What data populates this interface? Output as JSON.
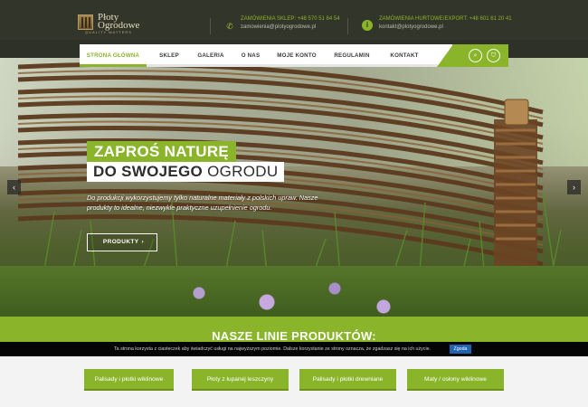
{
  "brand": {
    "name_line1": "Płoty",
    "name_line2": "Ogrodowe",
    "tagline": "QUALITY MATTERS"
  },
  "contact_shop": {
    "label": "ZAMÓWIENIA SKLEP:",
    "phone": "+48 570 51 84 54",
    "email": "zamowienia@plotyogrodowe.pl"
  },
  "contact_wholesale": {
    "label": "ZAMÓWIENIA HURTOWE/EXPORT:",
    "phone": "+48 601 61 20 41",
    "email": "kontakt@plotyogrodowe.pl"
  },
  "nav": {
    "items": [
      "STRONA GŁÓWNA",
      "SKLEP",
      "GALERIA",
      "O NAS",
      "MOJE KONTO",
      "REGULAMIN",
      "KONTAKT"
    ],
    "active": "STRONA GŁÓWNA"
  },
  "hero": {
    "headline1": "ZAPROŚ NATURĘ",
    "headline2_bold": "DO SWOJEGO",
    "headline2_rest": "OGRODU",
    "description": "Do produkcji wykorzystujemy tylko naturalne materiały z polskich upraw. Nasze produkty to idealne, niezwykle praktyczne uzupełnienie ogrodu.",
    "cta_label": "PRODUKTY",
    "cta_arrow": "›",
    "prev_arrow": "‹",
    "next_arrow": "›"
  },
  "products_section": {
    "title": "NASZE LINIE PRODUKTÓW:"
  },
  "cookie": {
    "text": "Ta strona korzysta z ciasteczek aby świadczyć usługi na najwyższym poziomie. Dalsze korzystanie ze strony oznacza, że zgadzasz się na ich użycie.",
    "accept_label": "Zgoda"
  },
  "product_lines": [
    "Palisady i płotki wiklinowe",
    "Płoty z łupanej leszczyny",
    "Palisady i płotki drewniane",
    "Maty / osłony wiklinowe"
  ],
  "colors": {
    "accent": "#8ab42a",
    "header_bg": "#323529",
    "cookie_button": "#1f63b3"
  },
  "icons": {
    "phone": "phone-icon",
    "info": "info-icon",
    "search": "search-icon",
    "cart": "cart-icon"
  }
}
